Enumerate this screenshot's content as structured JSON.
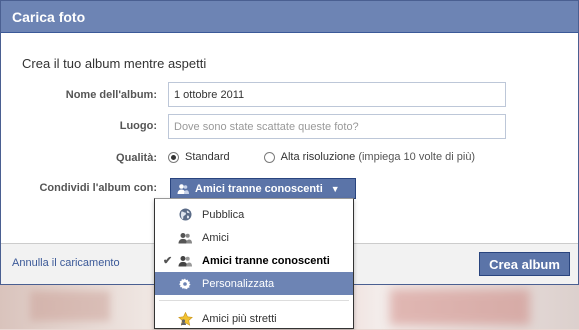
{
  "dialog": {
    "title": "Carica foto",
    "subtitle": "Crea il tuo album mentre aspetti"
  },
  "form": {
    "album_name_label": "Nome dell'album:",
    "album_name_value": "1 ottobre 2011",
    "location_label": "Luogo:",
    "location_placeholder": "Dove sono state scattate queste foto?",
    "quality_label": "Qualità:",
    "quality_standard": "Standard",
    "quality_high": "Alta risoluzione",
    "quality_high_note": "(impiega 10 volte di più)",
    "share_label": "Condividi l'album con:",
    "share_value": "Amici tranne conoscenti"
  },
  "menu": {
    "items": [
      {
        "label": "Pubblica",
        "icon": "globe-icon"
      },
      {
        "label": "Amici",
        "icon": "friends-icon"
      },
      {
        "label": "Amici tranne conoscenti",
        "icon": "friends-except-icon",
        "checked": true
      },
      {
        "label": "Personalizzata",
        "icon": "gear-icon",
        "highlighted": true
      },
      {
        "label": "Amici più stretti",
        "icon": "star-icon"
      }
    ]
  },
  "footer": {
    "cancel_label": "Annulla il caricamento",
    "create_label": "Crea album"
  },
  "colors": {
    "titlebar": "#6d84b4",
    "button": "#5b74a8",
    "highlight": "#6d84b4",
    "link": "#3b5998"
  }
}
